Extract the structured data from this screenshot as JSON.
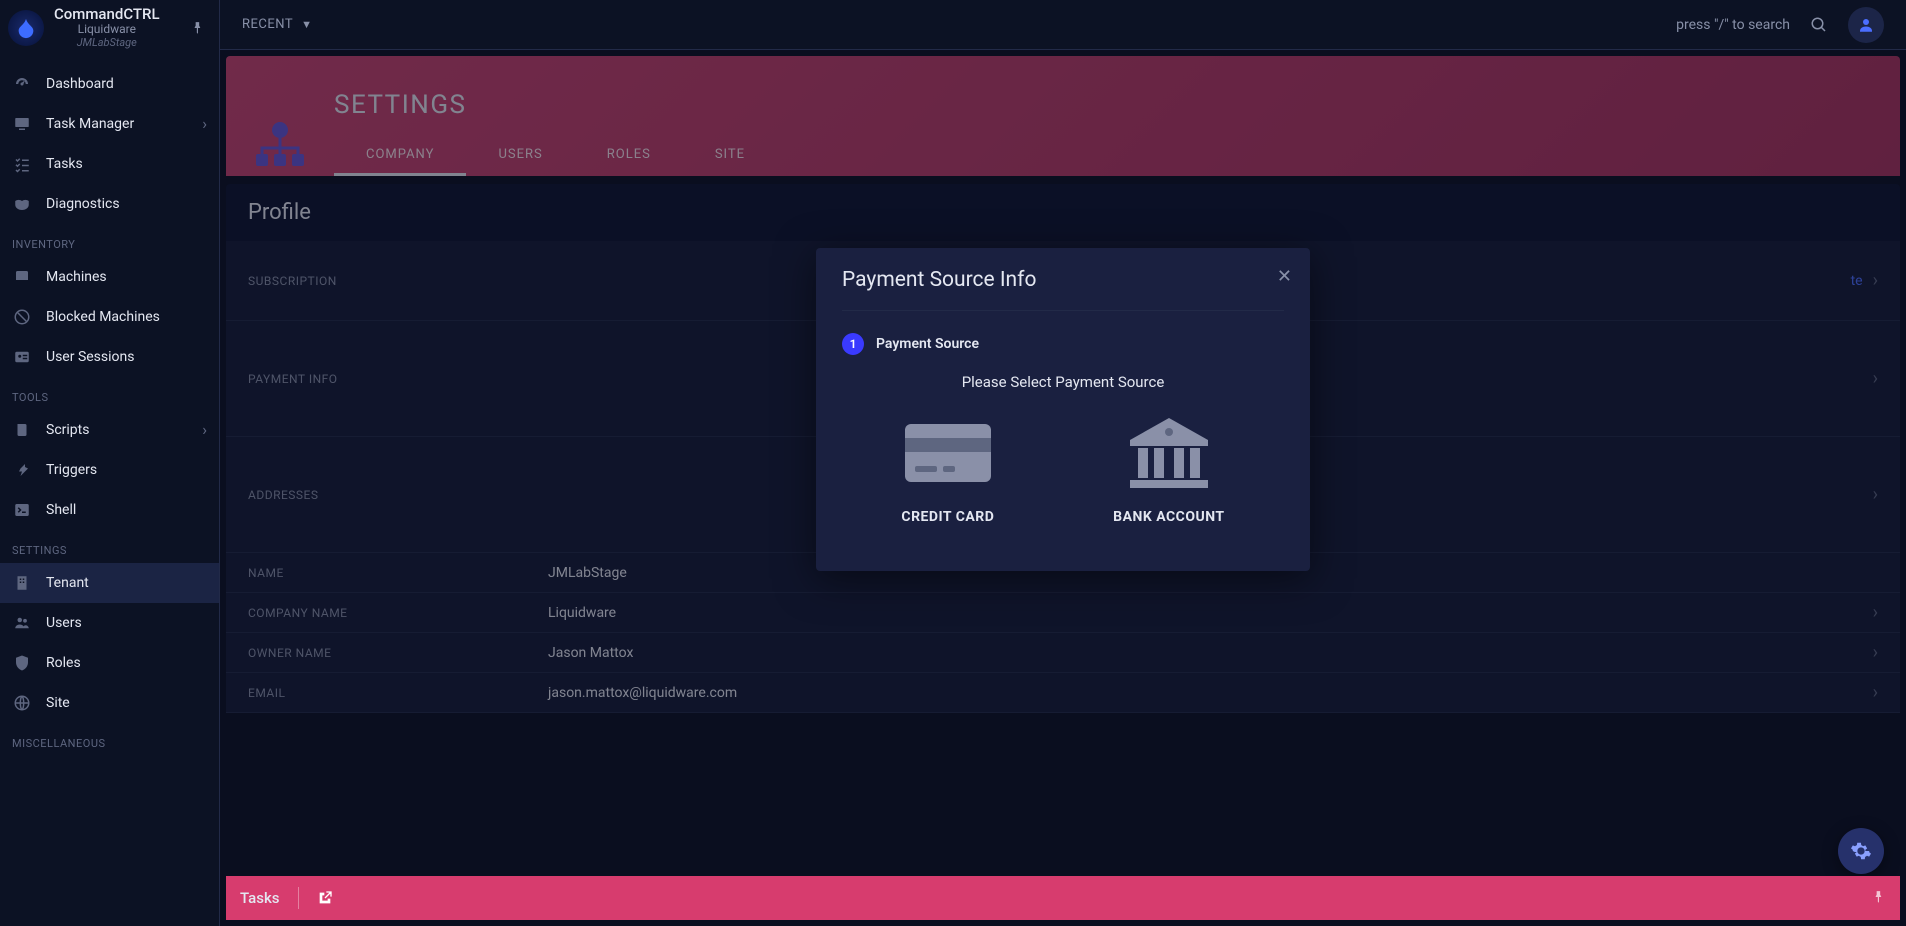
{
  "brand": {
    "title": "CommandCTRL",
    "subtitle": "Liquidware",
    "subtitle2": "JMLabStage"
  },
  "sidebar": {
    "sections": [
      {
        "label": null,
        "items": [
          {
            "id": "dashboard",
            "label": "Dashboard",
            "icon": "gauge-icon",
            "expandable": false
          },
          {
            "id": "task-manager",
            "label": "Task Manager",
            "icon": "monitor-icon",
            "expandable": true
          },
          {
            "id": "tasks",
            "label": "Tasks",
            "icon": "list-check-icon",
            "expandable": false
          },
          {
            "id": "diagnostics",
            "label": "Diagnostics",
            "icon": "mask-icon",
            "expandable": false
          }
        ]
      },
      {
        "label": "INVENTORY",
        "items": [
          {
            "id": "machines",
            "label": "Machines",
            "icon": "server-icon",
            "expandable": false
          },
          {
            "id": "blocked-machines",
            "label": "Blocked Machines",
            "icon": "blocked-icon",
            "expandable": false
          },
          {
            "id": "user-sessions",
            "label": "User Sessions",
            "icon": "id-card-icon",
            "expandable": false
          }
        ]
      },
      {
        "label": "TOOLS",
        "items": [
          {
            "id": "scripts",
            "label": "Scripts",
            "icon": "scroll-icon",
            "expandable": true
          },
          {
            "id": "triggers",
            "label": "Triggers",
            "icon": "bolt-icon",
            "expandable": false
          },
          {
            "id": "shell",
            "label": "Shell",
            "icon": "terminal-icon",
            "expandable": false
          }
        ]
      },
      {
        "label": "SETTINGS",
        "items": [
          {
            "id": "tenant",
            "label": "Tenant",
            "icon": "building-icon",
            "expandable": false,
            "active": true
          },
          {
            "id": "users",
            "label": "Users",
            "icon": "users-icon",
            "expandable": false
          },
          {
            "id": "roles",
            "label": "Roles",
            "icon": "shield-icon",
            "expandable": false
          },
          {
            "id": "site",
            "label": "Site",
            "icon": "globe-icon",
            "expandable": false
          }
        ]
      },
      {
        "label": "MISCELLANEOUS",
        "items": []
      }
    ]
  },
  "topbar": {
    "recent_label": "RECENT",
    "search_hint": "press \"/\" to search"
  },
  "header": {
    "title": "SETTINGS",
    "tabs": [
      "COMPANY",
      "USERS",
      "ROLES",
      "SITE"
    ],
    "active_tab": 0
  },
  "section_title": "Profile",
  "rows": [
    {
      "label": "SUBSCRIPTION",
      "value": "",
      "tall": 2,
      "chevron": true,
      "right_link": "te"
    },
    {
      "label": "PAYMENT INFO",
      "value": "",
      "tall": 3,
      "chevron": true
    },
    {
      "label": "ADDRESSES",
      "value": "",
      "tall": 3,
      "chevron": true
    },
    {
      "label": "NAME",
      "value": "JMLabStage",
      "chevron": false
    },
    {
      "label": "COMPANY NAME",
      "value": "Liquidware",
      "chevron": true
    },
    {
      "label": "OWNER NAME",
      "value": "Jason Mattox",
      "chevron": true
    },
    {
      "label": "EMAIL",
      "value": "jason.mattox@liquidware.com",
      "chevron": true
    }
  ],
  "tasks_bar": {
    "label": "Tasks"
  },
  "modal": {
    "title": "Payment Source Info",
    "step_number": "1",
    "step_label": "Payment Source",
    "prompt": "Please Select Payment Source",
    "choices": [
      {
        "id": "credit-card",
        "label": "CREDIT CARD"
      },
      {
        "id": "bank-account",
        "label": "BANK ACCOUNT"
      }
    ]
  }
}
